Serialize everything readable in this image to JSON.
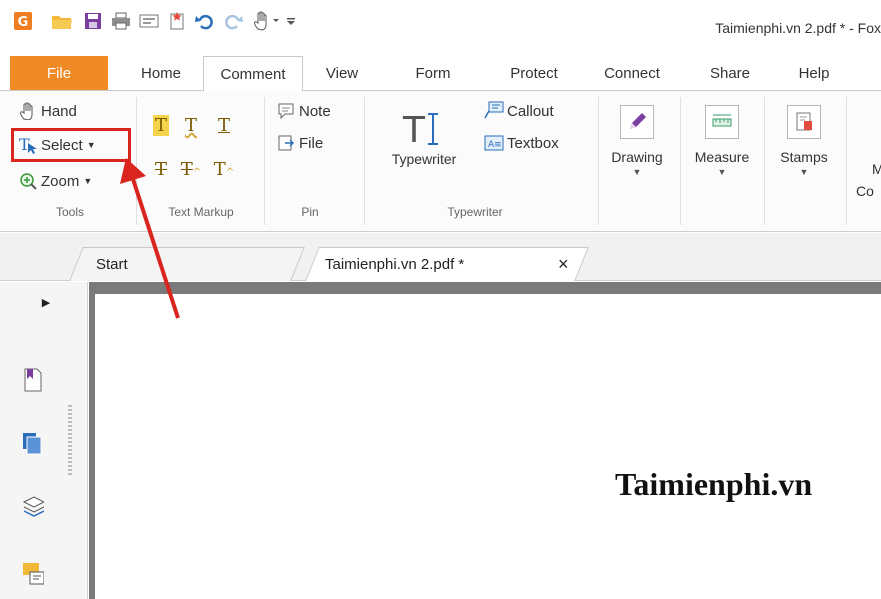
{
  "window": {
    "title": "Taimienphi.vn 2.pdf * - Fox"
  },
  "quick_access": {
    "icons": [
      "foxit-logo-icon",
      "open-folder-icon",
      "save-icon",
      "print-icon",
      "scan-icon",
      "new-icon",
      "undo-icon",
      "redo-icon",
      "hand-tool-icon",
      "customize-dropdown-icon"
    ]
  },
  "ribbon_tabs": [
    "File",
    "Home",
    "Comment",
    "View",
    "Form",
    "Protect",
    "Connect",
    "Share",
    "Help"
  ],
  "active_tab": "Comment",
  "ribbon": {
    "tools": {
      "hand": "Hand",
      "select": "Select",
      "zoom": "Zoom",
      "label": "Tools"
    },
    "text_markup": {
      "label": "Text Markup"
    },
    "pin": {
      "note": "Note",
      "file": "File",
      "label": "Pin"
    },
    "typewriter": {
      "typewriter": "Typewriter",
      "callout": "Callout",
      "textbox": "Textbox",
      "label": "Typewriter"
    },
    "drawing": "Drawing",
    "measure": "Measure",
    "stamps": "Stamps",
    "cut_off_top": "M",
    "cut_off_bottom": "Co"
  },
  "doc_tabs": {
    "start": "Start",
    "file": "Taimienphi.vn 2.pdf *",
    "close": "×"
  },
  "document": {
    "heading": "Taimienphi.vn"
  },
  "colors": {
    "file_tab": "#f08a24",
    "highlight": "#d9251d",
    "accent_blue": "#2a6ebb"
  }
}
